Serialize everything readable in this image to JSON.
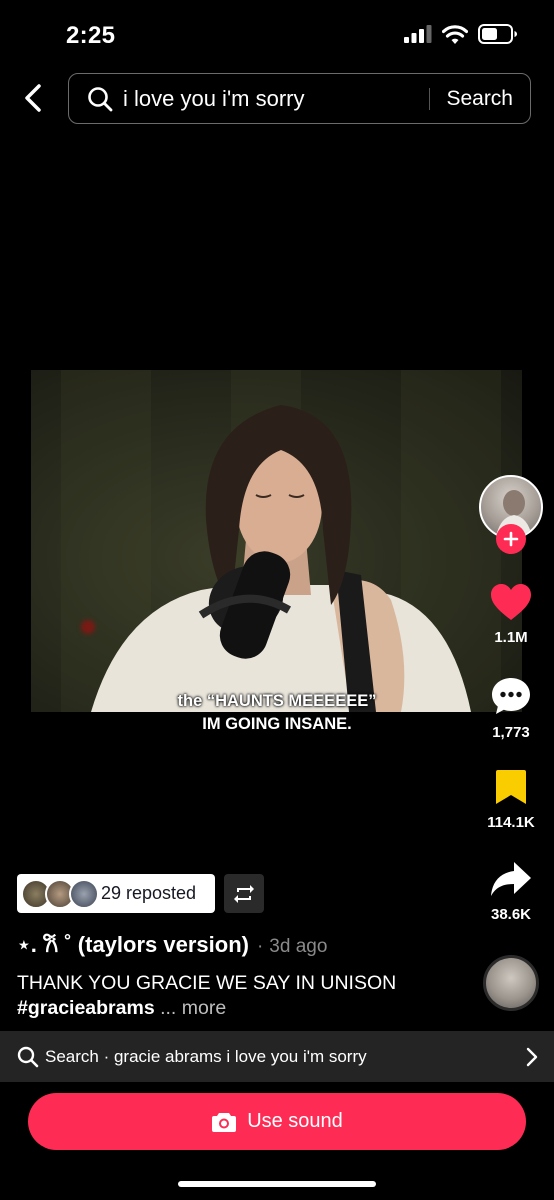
{
  "status_bar": {
    "time": "2:25"
  },
  "header": {
    "search_query": "i love you i'm sorry",
    "search_button_label": "Search"
  },
  "video": {
    "subtitle_line1": "the “HAUNTS MEEEEEE”",
    "subtitle_line2": "IM GOING INSANE."
  },
  "actions": {
    "likes": "1.1M",
    "comments": "1,773",
    "saves": "114.1K",
    "shares": "38.6K"
  },
  "repost": {
    "label": "29 reposted"
  },
  "author": {
    "name": "⋆. 𐙚 ˚ (taylors version)",
    "separator": "·",
    "time_ago": "3d ago"
  },
  "caption": {
    "text": "THANK YOU GRACIE WE SAY IN UNISON",
    "hashtag": "#gracieabrams",
    "more": "... more"
  },
  "related_search": {
    "text": "Search · gracie abrams i love you i'm sorry"
  },
  "use_sound": {
    "label": "Use sound"
  },
  "colors": {
    "accent": "#fe2c55",
    "save_yellow": "#facd00"
  }
}
